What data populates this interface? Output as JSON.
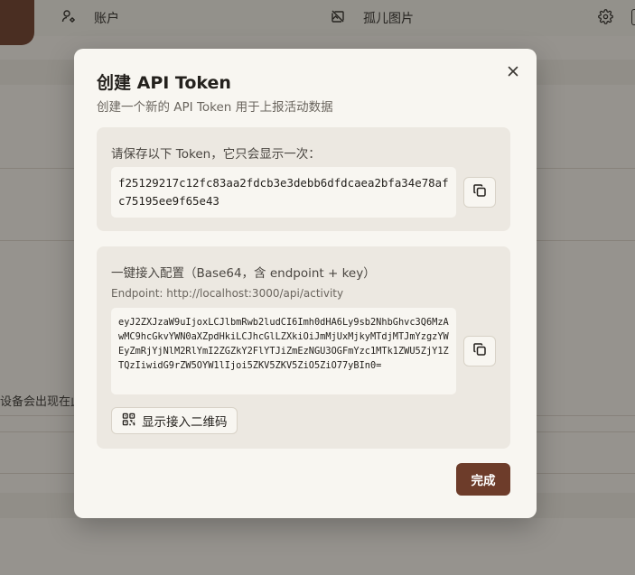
{
  "nav": {
    "account_label": "账户",
    "orphans_label": "孤儿图片"
  },
  "background": {
    "hint_text": "设备会出现在此"
  },
  "modal": {
    "title": "创建 API Token",
    "description": "创建一个新的 API Token 用于上报活动数据",
    "token_section": {
      "label": "请保存以下 Token，它只会显示一次：",
      "token_value": "f25129217c12fc83aa2fdcb3e3debb6dfdcaea2bfa34e78afc75195ee9f65e43"
    },
    "config_section": {
      "label": "一键接入配置（Base64，含 endpoint + key）",
      "endpoint": "Endpoint: http://localhost:3000/api/activity",
      "config_value": "eyJ2ZXJzaW9uIjoxLCJlbmRwb2ludCI6Imh0dHA6Ly9sb2NhbGhvc3Q6MzAwMC9hcGkvYWN0aXZpdHkiLCJhcGlLZXkiOiJmMjUxMjkyMTdjMTJmYzgzYWEyZmRjYjNlM2RlYmI2ZGZkY2FlYTJiZmEzNGU3OGFmYzc1MTk1ZWU5ZjY1ZTQzIiwidG9rZW5OYW1lIjoi5ZKV5ZKV5ZiO5ZiO77yBIn0=",
      "qr_button_label": "显示接入二维码"
    },
    "done_label": "完成"
  },
  "colors": {
    "accent": "#6d3c2a",
    "modal_bg": "#f8f6f1",
    "panel_bg": "#ece8e1"
  },
  "icons": {
    "account": "user-settings-icon",
    "orphans": "image-off-icon",
    "settings": "gear-icon",
    "close": "close-icon",
    "copy": "copy-icon",
    "qr": "qr-code-icon"
  }
}
